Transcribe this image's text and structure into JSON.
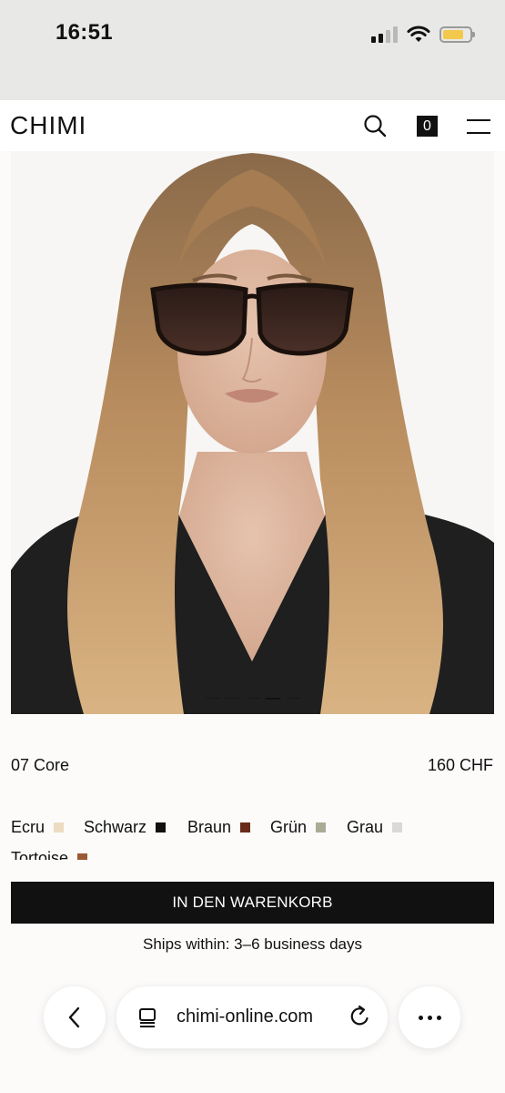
{
  "status_bar": {
    "time": "16:51",
    "signal_icon": "cellular-signal-icon",
    "wifi_icon": "wifi-icon",
    "battery_icon": "battery-icon",
    "battery_color": "#f2c94c"
  },
  "header": {
    "logo": "CHIMI",
    "search_icon": "search-icon",
    "cart_count": "0",
    "menu_icon": "hamburger-menu-icon"
  },
  "product": {
    "image_description_icon": "product-photo",
    "name": "07 Core",
    "price": "160 CHF",
    "colors": [
      {
        "label": "Ecru",
        "swatch": "#ecdcc2"
      },
      {
        "label": "Schwarz",
        "swatch": "#111111"
      },
      {
        "label": "Braun",
        "swatch": "#6a2a1a"
      },
      {
        "label": "Grün",
        "swatch": "#a9ad96"
      },
      {
        "label": "Grau",
        "swatch": "#d9d9d9"
      },
      {
        "label": "Tortoise",
        "swatch": "#9a5a35"
      }
    ],
    "cart_button": "IN DEN WARENKORB",
    "shipping": "Ships within: 3–6 business days"
  },
  "browser": {
    "url": "chimi-online.com",
    "back_icon": "chevron-left-icon",
    "tabs_icon": "tabs-icon",
    "reload_icon": "reload-icon",
    "more_icon": "more-dots-icon"
  },
  "carousel": {
    "slide_count": 5,
    "active_index": 3
  }
}
